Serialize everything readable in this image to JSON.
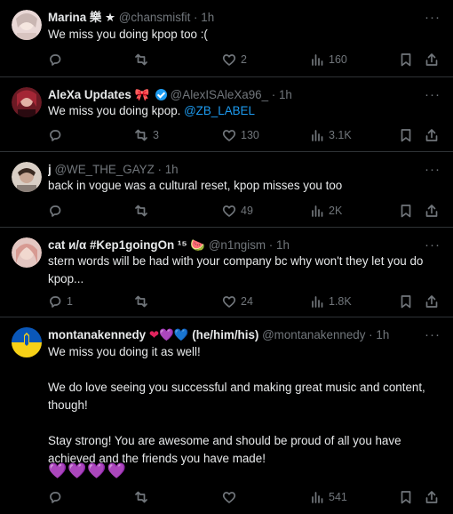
{
  "tweets": [
    {
      "name": "Marina 樂 ★",
      "handle": "@chansmisfit",
      "time": "1h",
      "text": "We miss you doing kpop too :(",
      "replies": "",
      "retweets": "",
      "likes": "2",
      "views": "160"
    },
    {
      "name": "AleXa Updates",
      "name_emoji": "🎀",
      "handle": "@AlexISAleXa96_",
      "time": "1h",
      "text": "We miss you doing kpop.",
      "mention": "@ZB_LABEL",
      "replies": "",
      "retweets": "3",
      "likes": "130",
      "views": "3.1K"
    },
    {
      "name": "j",
      "handle": "@WE_THE_GAYZ",
      "time": "1h",
      "text": "back in vogue was a cultural reset, kpop misses you too",
      "replies": "",
      "retweets": "",
      "likes": "49",
      "views": "2K"
    },
    {
      "name": "cat ᴎ/α #Kep1goingOn ¹⁵",
      "name_emoji": "🍉",
      "handle": "@n1ngism",
      "time": "1h",
      "text": "stern words will be had with your company bc why won't they let you do kpop...",
      "replies": "1",
      "retweets": "",
      "likes": "24",
      "views": "1.8K"
    },
    {
      "name": "montanakennedy",
      "name_hearts": [
        "❤",
        "💜",
        "💙"
      ],
      "pronouns": "(he/him/his)",
      "handle": "@montanakennedy",
      "time": "1h",
      "text": "We miss you doing it as well!\n\nWe do love seeing you successful and making great music and content, though!\n\nStay strong! You are awesome and should be proud of all you have achieved and the friends you have made!",
      "emoji_line": "💜💜💜💜",
      "replies": "",
      "retweets": "",
      "likes": "",
      "views": "541"
    }
  ],
  "ui": {
    "dot": "·",
    "more": "···"
  },
  "colors": {
    "background": "#000000",
    "text": "#e7e9ea",
    "muted": "#71767b",
    "link": "#1d9bf0",
    "divider": "#2f3336"
  }
}
